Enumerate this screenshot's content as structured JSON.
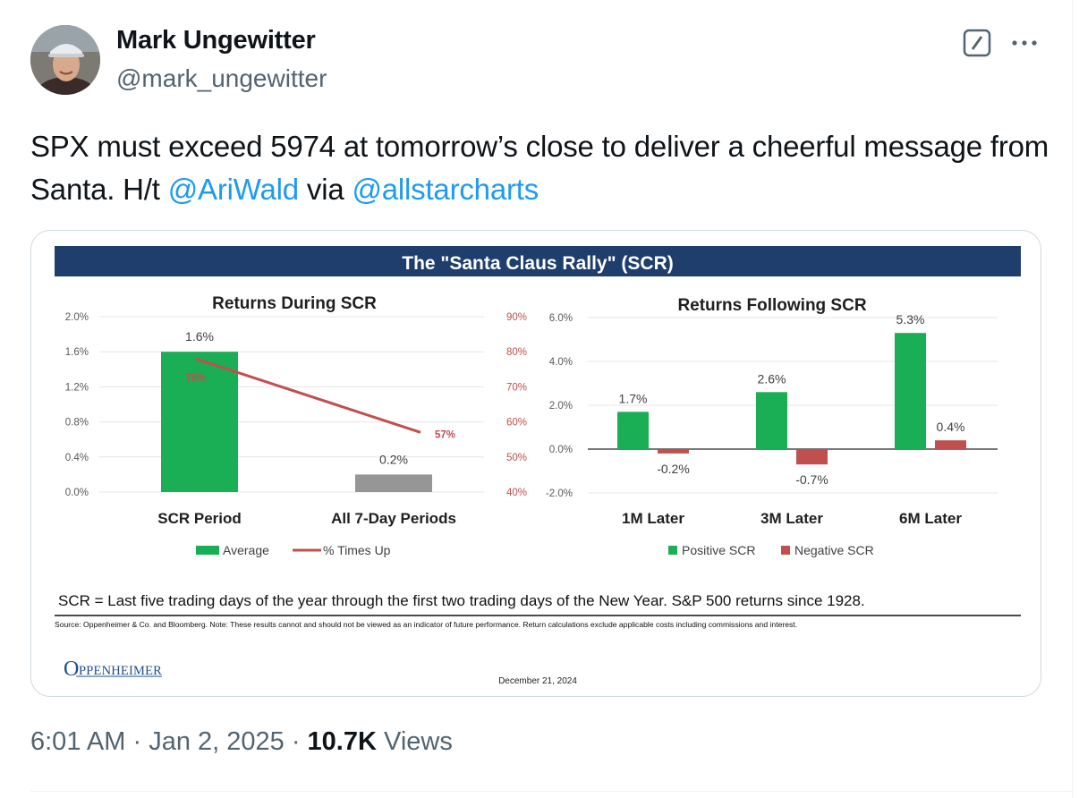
{
  "author": {
    "display_name": "Mark Ungewitter",
    "handle": "@mark_ungewitter"
  },
  "header_icons": {
    "grok": "grok-icon",
    "more": "more-icon"
  },
  "tweet": {
    "text_part1": "SPX must exceed 5974 at tomorrow’s close to deliver a cheerful message from Santa. H/t ",
    "mention1": "@AriWald",
    "text_part2": " via ",
    "mention2": "@allstarcharts"
  },
  "media": {
    "banner_title": "The \"Santa Claus Rally\" (SCR)",
    "definition": "SCR = Last five trading days of the year through the first two trading days of the New Year.  S&P 500 returns since 1928.",
    "source": "Source: Oppenheimer & Co. and Bloomberg. Note: These results cannot and should not be viewed as an indicator of future performance. Return calculations exclude applicable costs including commissions and interest.",
    "logo_text": "OPPENHEIMER",
    "date": "December 21, 2024"
  },
  "chart_data": [
    {
      "type": "bar",
      "title": "Returns During SCR",
      "categories": [
        "SCR Period",
        "All 7-Day Periods"
      ],
      "series": [
        {
          "name": "Average",
          "values": [
            1.6,
            0.2
          ],
          "labels": [
            "1.6%",
            "0.2%"
          ],
          "colors": [
            "#1aaf54",
            "#969696"
          ]
        },
        {
          "name": "% Times Up",
          "type": "line",
          "axis": "right",
          "values": [
            78,
            57
          ],
          "labels": [
            "78%",
            "57%"
          ],
          "color": "#c0504d"
        }
      ],
      "y_left": {
        "min": 0,
        "max": 2.0,
        "ticks": [
          "2.0%",
          "1.6%",
          "1.2%",
          "0.8%",
          "0.4%",
          "0.0%"
        ],
        "tick_values": [
          2.0,
          1.6,
          1.2,
          0.8,
          0.4,
          0.0
        ]
      },
      "y_right": {
        "min": 40,
        "max": 90,
        "ticks": [
          "90%",
          "80%",
          "70%",
          "60%",
          "50%",
          "40%"
        ],
        "tick_values": [
          90,
          80,
          70,
          60,
          50,
          40
        ]
      },
      "legend": "bottom"
    },
    {
      "type": "bar",
      "title": "Returns Following SCR",
      "categories": [
        "1M Later",
        "3M Later",
        "6M Later"
      ],
      "series": [
        {
          "name": "Positive SCR",
          "values": [
            1.7,
            2.6,
            5.3
          ],
          "labels": [
            "1.7%",
            "2.6%",
            "5.3%"
          ],
          "color": "#1aaf54"
        },
        {
          "name": "Negative SCR",
          "values": [
            -0.2,
            -0.7,
            0.4
          ],
          "labels": [
            "-0.2%",
            "-0.7%",
            "0.4%"
          ],
          "color": "#c0504d"
        }
      ],
      "y": {
        "min": -2.0,
        "max": 6.0,
        "ticks": [
          "6.0%",
          "4.0%",
          "2.0%",
          "0.0%",
          "-2.0%"
        ],
        "tick_values": [
          6.0,
          4.0,
          2.0,
          0.0,
          -2.0
        ]
      },
      "legend": "bottom"
    }
  ],
  "footer": {
    "time": "6:01 AM",
    "sep1": " · ",
    "date": "Jan 2, 2025",
    "sep2": " · ",
    "views_count": "10.7K",
    "views_label": " Views"
  }
}
